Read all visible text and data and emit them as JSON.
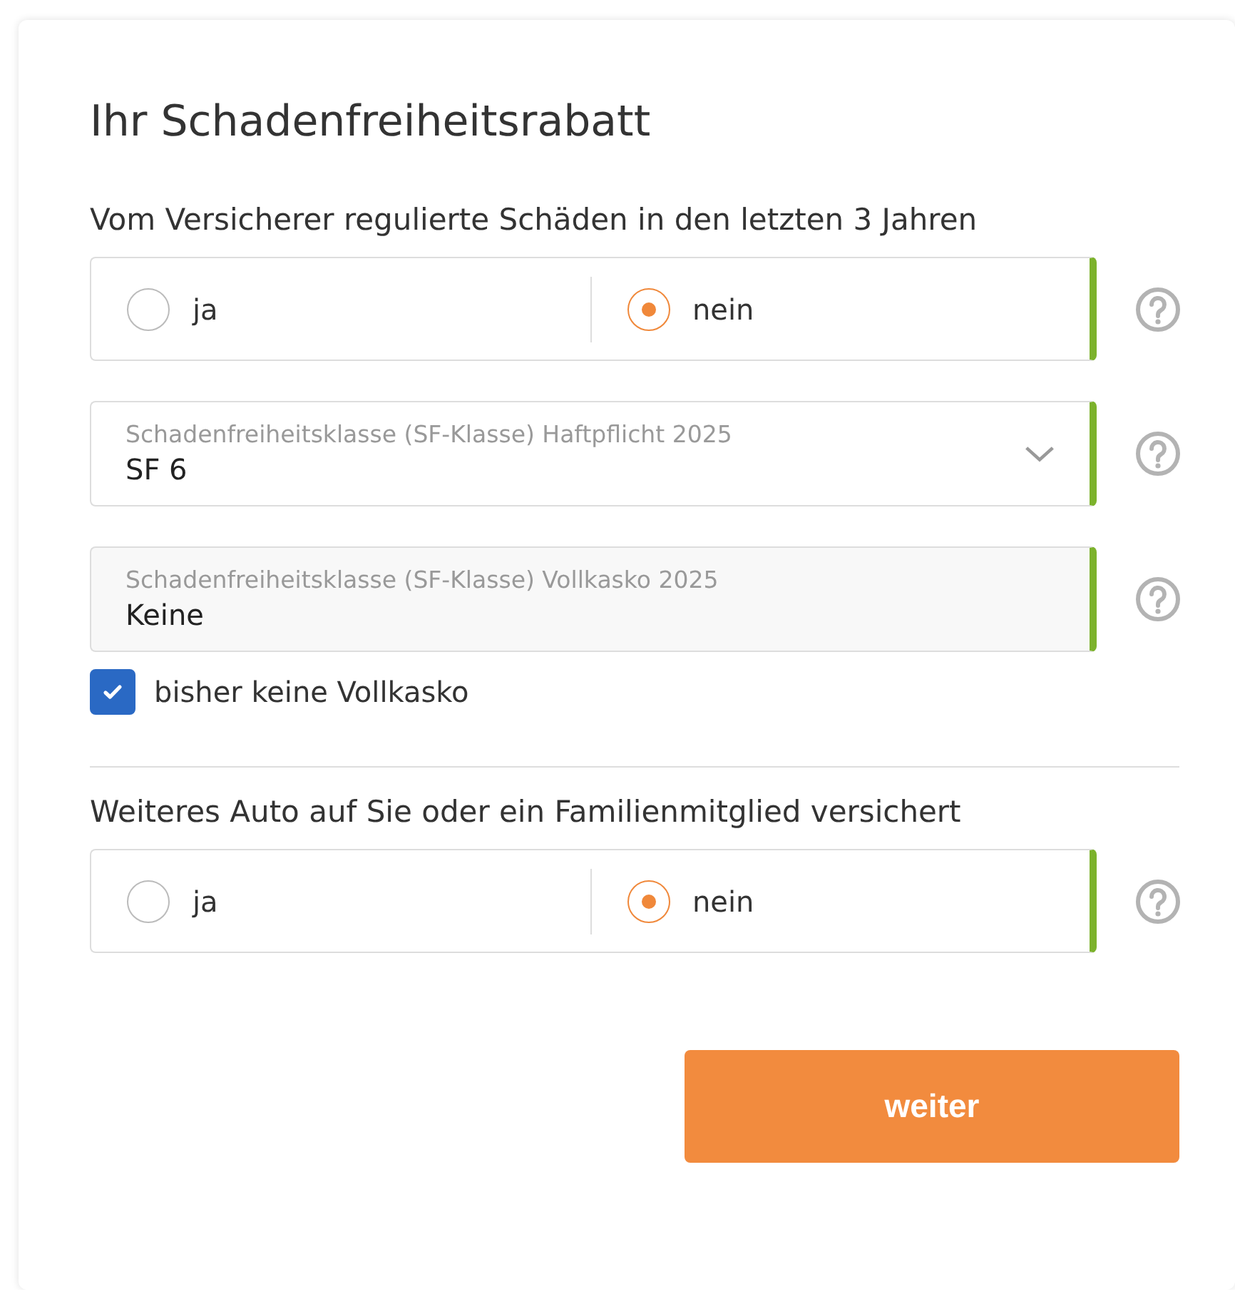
{
  "title": "Ihr Schadenfreiheitsrabatt",
  "items": [
    {
      "kind": "radio_group",
      "question": "Vom Versicherer regulierte Schäden in den letzten 3 Jahren",
      "valid": true,
      "options": [
        {
          "label": "ja",
          "selected": false
        },
        {
          "label": "nein",
          "selected": true
        }
      ]
    },
    {
      "kind": "select",
      "label": "Schadenfreiheitsklasse (SF-Klasse) Haftpflicht 2025",
      "value": "SF 6",
      "valid": true,
      "disabled": false
    },
    {
      "kind": "select",
      "label": "Schadenfreiheitsklasse (SF-Klasse) Vollkasko 2025",
      "value": "Keine",
      "valid": true,
      "disabled": true
    },
    {
      "kind": "checkbox",
      "label": "bisher keine Vollkasko",
      "checked": true
    },
    {
      "kind": "divider"
    },
    {
      "kind": "radio_group",
      "question": "Weiteres Auto auf Sie oder ein Familienmitglied versichert",
      "valid": true,
      "options": [
        {
          "label": "ja",
          "selected": false
        },
        {
          "label": "nein",
          "selected": true
        }
      ]
    }
  ],
  "submit": "weiter"
}
